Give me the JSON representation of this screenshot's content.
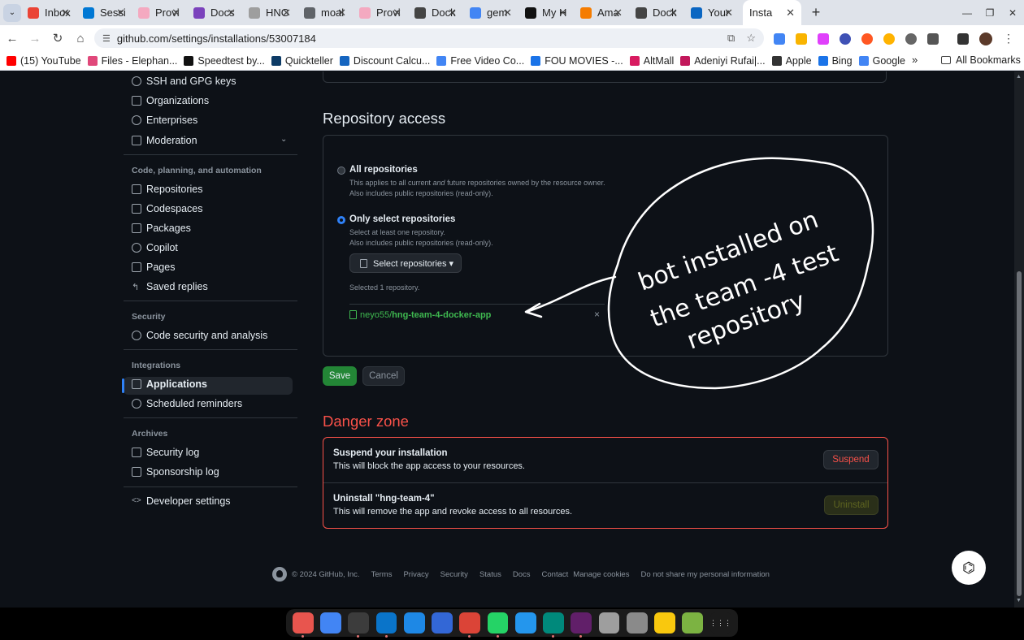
{
  "browser": {
    "tabs": [
      {
        "label": "Inbox",
        "color": "#ea4335"
      },
      {
        "label": "Sessi",
        "color": "#0078d4"
      },
      {
        "label": "Provi",
        "color": "#f4a9c0"
      },
      {
        "label": "Docs",
        "color": "#7b42bc"
      },
      {
        "label": "HNG",
        "color": "#9e9e9e"
      },
      {
        "label": "moal",
        "color": "#5f6368"
      },
      {
        "label": "Provi",
        "color": "#f4a9c0"
      },
      {
        "label": "Dock",
        "color": "#444444"
      },
      {
        "label": "gem",
        "color": "#4285f4"
      },
      {
        "label": "My H",
        "color": "#111111"
      },
      {
        "label": "Ama",
        "color": "#f57c00"
      },
      {
        "label": "Dock",
        "color": "#444444"
      },
      {
        "label": "Your",
        "color": "#0a66c2"
      }
    ],
    "active_tab": {
      "label": "Insta"
    },
    "url": "github.com/settings/installations/53007184",
    "bookmarks": [
      {
        "label": "(15) YouTube",
        "color": "#ff0000"
      },
      {
        "label": "Files - Elephan...",
        "color": "#e0487a"
      },
      {
        "label": "Speedtest by...",
        "color": "#111111"
      },
      {
        "label": "Quickteller",
        "color": "#0d3b66"
      },
      {
        "label": "Discount Calcu...",
        "color": "#1565c0"
      },
      {
        "label": "Free Video Co...",
        "color": "#4285f4"
      },
      {
        "label": "FOU MOVIES -...",
        "color": "#1a73e8"
      },
      {
        "label": "AltMall",
        "color": "#d81b60"
      },
      {
        "label": "Adeniyi Rufai|...",
        "color": "#c2185b"
      },
      {
        "label": "Apple",
        "color": "#333333"
      },
      {
        "label": "Bing",
        "color": "#1a73e8"
      },
      {
        "label": "Google",
        "color": "#4285f4"
      }
    ],
    "bookmarks_more": "»",
    "all_bookmarks": "All Bookmarks"
  },
  "sidebar": {
    "items_top": [
      {
        "label": "SSH and GPG keys",
        "icon": "key-icon"
      },
      {
        "label": "Organizations",
        "icon": "organization-icon"
      },
      {
        "label": "Enterprises",
        "icon": "globe-icon"
      },
      {
        "label": "Moderation",
        "icon": "report-icon"
      }
    ],
    "section_code": "Code, planning, and automation",
    "items_code": [
      {
        "label": "Repositories",
        "icon": "repo-icon"
      },
      {
        "label": "Codespaces",
        "icon": "codespaces-icon"
      },
      {
        "label": "Packages",
        "icon": "package-icon"
      },
      {
        "label": "Copilot",
        "icon": "copilot-icon"
      },
      {
        "label": "Pages",
        "icon": "browser-icon"
      },
      {
        "label": "Saved replies",
        "icon": "reply-icon"
      }
    ],
    "section_security": "Security",
    "items_security": [
      {
        "label": "Code security and analysis",
        "icon": "shield-lock-icon"
      }
    ],
    "section_integrations": "Integrations",
    "items_integrations": [
      {
        "label": "Applications",
        "icon": "apps-icon"
      },
      {
        "label": "Scheduled reminders",
        "icon": "clock-icon"
      }
    ],
    "section_archives": "Archives",
    "items_archives": [
      {
        "label": "Security log",
        "icon": "log-icon"
      },
      {
        "label": "Sponsorship log",
        "icon": "log-icon"
      }
    ],
    "developer_settings": "Developer settings"
  },
  "repo_access": {
    "heading": "Repository access",
    "all": {
      "title": "All repositories",
      "desc_pre": "This applies to all current ",
      "desc_em": "and",
      "desc_post": " future repositories owned by the resource owner.",
      "desc2": "Also includes public repositories (read-only)."
    },
    "select": {
      "title": "Only select repositories",
      "desc1": "Select at least one repository.",
      "desc2": "Also includes public repositories (read-only)."
    },
    "select_button": "Select repositories ▾",
    "selected_count": "Selected 1 repository.",
    "repo_owner": "neyo55/",
    "repo_name": "hng-team-4-docker-app",
    "remove": "×",
    "save": "Save",
    "cancel": "Cancel"
  },
  "danger": {
    "heading": "Danger zone",
    "suspend_title": "Suspend your installation",
    "suspend_desc": "This will block the app access to your resources.",
    "suspend_button": "Suspend",
    "uninstall_title": "Uninstall \"hng-team-4\"",
    "uninstall_desc": "This will remove the app and revoke access to all resources.",
    "uninstall_button": "Uninstall"
  },
  "annotation": {
    "line1": "bot installed on",
    "line2": "the team -4 test",
    "line3": "repository"
  },
  "footer": {
    "copyright": "© 2024 GitHub, Inc.",
    "links": [
      "Terms",
      "Privacy",
      "Security",
      "Status",
      "Docs",
      "Contact",
      "Manage cookies",
      "Do not share my personal information"
    ]
  },
  "shelf_apps": [
    {
      "name": "files-app-icon",
      "color": "#e8554e",
      "dot": true
    },
    {
      "name": "docs-app-icon",
      "color": "#4285f4",
      "dot": false
    },
    {
      "name": "terminal-app-icon",
      "color": "#3c3c3c",
      "dot": true
    },
    {
      "name": "vscode-app-icon",
      "color": "#0a74c9",
      "dot": true
    },
    {
      "name": "drawio-app-icon",
      "color": "#1e88e5",
      "dot": false
    },
    {
      "name": "text-editor-app-icon",
      "color": "#3367d6",
      "dot": false
    },
    {
      "name": "chrome-app-icon",
      "color": "#db4437",
      "dot": true
    },
    {
      "name": "whatsapp-app-icon",
      "color": "#25d366",
      "dot": true
    },
    {
      "name": "docker-app-icon",
      "color": "#2496ed",
      "dot": false
    },
    {
      "name": "meet-app-icon",
      "color": "#00897b",
      "dot": true
    },
    {
      "name": "slack-app-icon",
      "color": "#611f69",
      "dot": true
    },
    {
      "name": "app-icon-gray-1",
      "color": "#9e9e9e",
      "dot": false
    },
    {
      "name": "app-icon-gray-2",
      "color": "#8a8a8a",
      "dot": false
    },
    {
      "name": "app-icon-yellow",
      "color": "#f9c80e",
      "dot": false
    },
    {
      "name": "app-icon-green",
      "color": "#7cb342",
      "dot": false
    },
    {
      "name": "launcher-app-icon",
      "color": "#1b1b1b",
      "dot": false
    }
  ]
}
